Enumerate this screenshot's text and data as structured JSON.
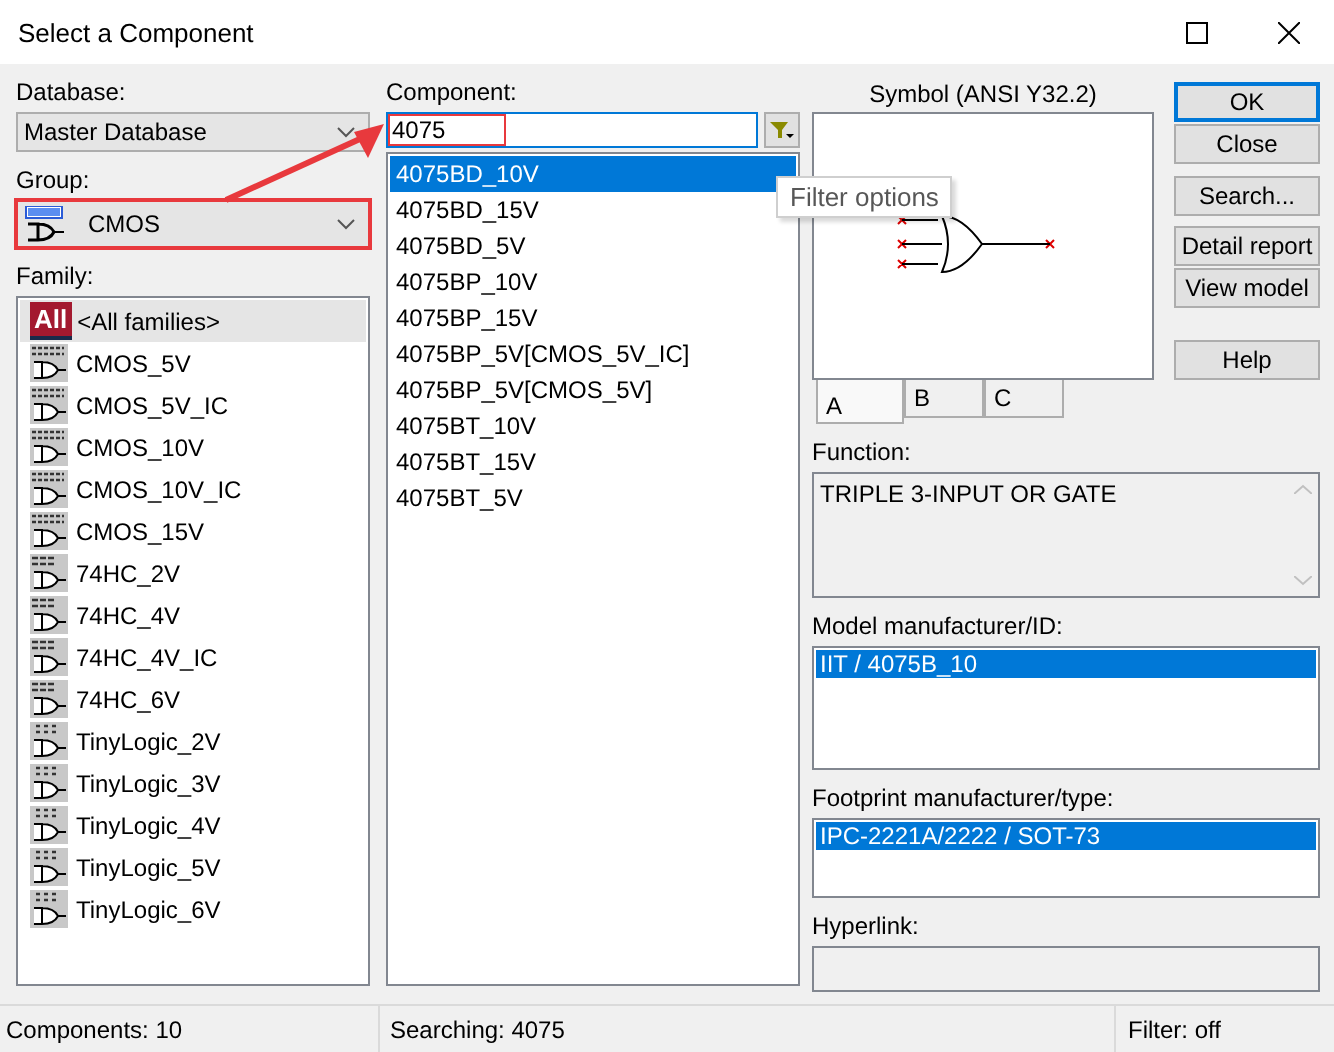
{
  "window": {
    "title": "Select a Component"
  },
  "database": {
    "label": "Database:",
    "value": "Master Database"
  },
  "group": {
    "label": "Group:",
    "value": "CMOS",
    "highlighted": true
  },
  "family": {
    "label": "Family:",
    "items": [
      {
        "kind": "all",
        "badge": "All",
        "label": "<All families>",
        "selected": true
      },
      {
        "kind": "cmos",
        "label": "CMOS_5V",
        "selected": false
      },
      {
        "kind": "cmos",
        "label": "CMOS_5V_IC",
        "selected": false
      },
      {
        "kind": "cmos",
        "label": "CMOS_10V",
        "selected": false
      },
      {
        "kind": "cmos",
        "label": "CMOS_10V_IC",
        "selected": false
      },
      {
        "kind": "cmos",
        "label": "CMOS_15V",
        "selected": false
      },
      {
        "kind": "hc",
        "label": "74HC_2V",
        "selected": false
      },
      {
        "kind": "hc",
        "label": "74HC_4V",
        "selected": false
      },
      {
        "kind": "hc",
        "label": "74HC_4V_IC",
        "selected": false
      },
      {
        "kind": "hc",
        "label": "74HC_6V",
        "selected": false
      },
      {
        "kind": "tiny",
        "label": "TinyLogic_2V",
        "selected": false
      },
      {
        "kind": "tiny",
        "label": "TinyLogic_3V",
        "selected": false
      },
      {
        "kind": "tiny",
        "label": "TinyLogic_4V",
        "selected": false
      },
      {
        "kind": "tiny",
        "label": "TinyLogic_5V",
        "selected": false
      },
      {
        "kind": "tiny",
        "label": "TinyLogic_6V",
        "selected": false
      }
    ]
  },
  "component": {
    "label": "Component:",
    "value": "4075",
    "highlighted": true,
    "items": [
      {
        "label": "4075BD_10V",
        "selected": true
      },
      {
        "label": "4075BD_15V",
        "selected": false
      },
      {
        "label": "4075BD_5V",
        "selected": false
      },
      {
        "label": "4075BP_10V",
        "selected": false
      },
      {
        "label": "4075BP_15V",
        "selected": false
      },
      {
        "label": "4075BP_5V[CMOS_5V_IC]",
        "selected": false
      },
      {
        "label": "4075BP_5V[CMOS_5V]",
        "selected": false
      },
      {
        "label": "4075BT_10V",
        "selected": false
      },
      {
        "label": "4075BT_15V",
        "selected": false
      },
      {
        "label": "4075BT_5V",
        "selected": false
      }
    ]
  },
  "tooltip": "Filter options",
  "annotation_arrow": true,
  "symbol": {
    "label": "Symbol (ANSI Y32.2)",
    "tabs": [
      {
        "label": "A",
        "selected": true
      },
      {
        "label": "B",
        "selected": false
      },
      {
        "label": "C",
        "selected": false
      }
    ]
  },
  "buttons": [
    {
      "label": "OK",
      "default": true
    },
    {
      "label": "Close",
      "default": false
    },
    {
      "label": "Search...",
      "default": false
    },
    {
      "label": "Detail report",
      "default": false
    },
    {
      "label": "View model",
      "default": false
    },
    {
      "label": "Help",
      "default": false
    }
  ],
  "function": {
    "label": "Function:",
    "value": "TRIPLE 3-INPUT OR GATE"
  },
  "model": {
    "label": "Model manufacturer/ID:",
    "items": [
      {
        "label": "IIT / 4075B_10",
        "selected": true
      }
    ]
  },
  "footprint": {
    "label": "Footprint manufacturer/type:",
    "items": [
      {
        "label": "IPC-2221A/2222 / SOT-73",
        "selected": true
      }
    ]
  },
  "hyperlink": {
    "label": "Hyperlink:"
  },
  "status_bar": [
    "Components: 10",
    "Searching: 4075",
    "Filter: off"
  ]
}
